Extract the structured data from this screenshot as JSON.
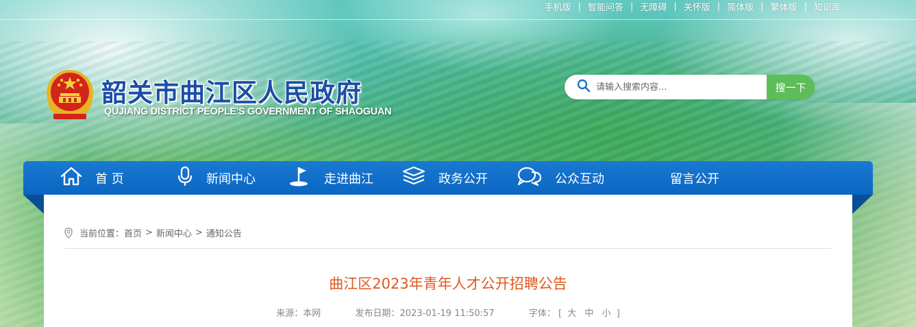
{
  "toplinks": [
    "手机版",
    "智能问答",
    "无障碍",
    "关怀版",
    "简体版",
    "繁体版",
    "知识库"
  ],
  "site": {
    "title": "韶关市曲江区人民政府",
    "subtitle": "QUJIANG DISTRICT PEOPLE'S GOVERNMENT OF SHAOGUAN"
  },
  "search": {
    "placeholder": "请输入搜索内容...",
    "button": "搜一下"
  },
  "nav": [
    {
      "label": "首 页",
      "icon": "home-icon"
    },
    {
      "label": "新闻中心",
      "icon": "microphone-icon"
    },
    {
      "label": "走进曲江",
      "icon": "flag-icon"
    },
    {
      "label": "政务公开",
      "icon": "stack-icon"
    },
    {
      "label": "公众互动",
      "icon": "chat-icon"
    },
    {
      "label": "留言公开",
      "icon": ""
    }
  ],
  "breadcrumb": {
    "prefix": "当前位置：",
    "items": [
      "首页",
      "新闻中心",
      "通知公告"
    ]
  },
  "article": {
    "title": "曲江区2023年青年人才公开招聘公告",
    "source_label": "来源：",
    "source": "本网",
    "date_label": "发布日期：",
    "date": "2023-01-19 11:50:57",
    "font_label": "字体：",
    "font_open": "[",
    "font_large": "大",
    "font_medium": "中",
    "font_small": "小",
    "font_close": "]"
  },
  "colors": {
    "nav_blue": "#0a66c2",
    "title_blue": "#1c4ea6",
    "search_green": "#5cbd59",
    "article_title": "#e0581f"
  }
}
